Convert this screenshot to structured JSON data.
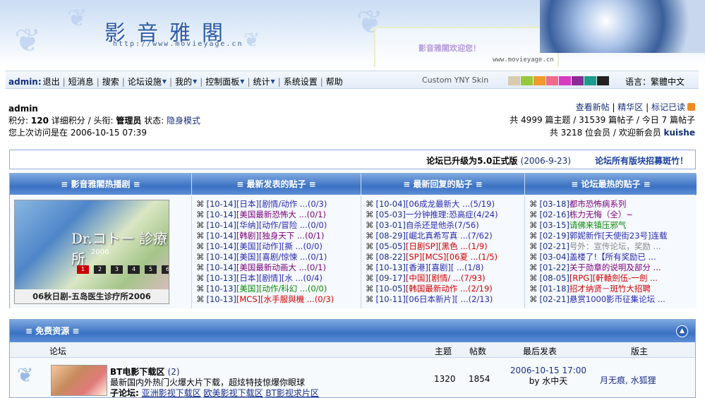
{
  "colors": {
    "accent": "#3b72c4",
    "link": "#14307a",
    "red": "#d40000",
    "green": "#0a8a0a"
  },
  "banner": {
    "logo": "影音雅閣",
    "logo_url": "http://www.movieyage.cn",
    "welcome": "影音雅閣欢迎您！",
    "site_url": "www.movieyage.cn"
  },
  "nav": {
    "user": "admin:",
    "items": [
      "退出",
      "短消息",
      "搜索",
      "论坛设施",
      "我的",
      "控制面板",
      "统计",
      "系统设置",
      "帮助"
    ],
    "skin": "Custom YNY Skin",
    "swatches": [
      "#d9cbb0",
      "#97c93b",
      "#f19a2e",
      "#f26a8a",
      "#d63bc2",
      "#8b2b94",
      "#1c9c8c",
      "#222222"
    ],
    "lang": "语言：繁體中文"
  },
  "user": {
    "name": "admin",
    "line2_pre": "积分:",
    "points": "120",
    "line2_mid": "详细积分 / 头衔:",
    "title": "管理员",
    "status_label": "状态:",
    "status": "隐身模式",
    "last_visit": "您上次访问是在 2006-10-15 07:39"
  },
  "stats": {
    "links": [
      "查看新帖",
      "精华区",
      "标记已读"
    ],
    "line2": "共 4999 篇主题 / 31539 篇帖子 / 今日 7 篇帖子",
    "line3_pre": "共 3218 位会员 / 欢迎新会员",
    "new_member": "kuishe"
  },
  "announce": {
    "msg": "论坛已升级为5.0正式版",
    "date": "(2006-9-23)",
    "recruit": "论坛所有版块招募斑竹！"
  },
  "hot": {
    "headers": [
      "≡ 影音雅閣热播剧 ≡",
      "≡ 最新发表的贴子 ≡",
      "≡ 最新回复的贴子 ≡",
      "≡ 论坛最热的贴子 ≡"
    ],
    "poster": {
      "title_art": "Dr.コトー 診療所",
      "year": "2006",
      "tiles": [
        "1",
        "2",
        "3",
        "4",
        "5",
        "6"
      ],
      "caption": "06秋日剧-五岛医生诊疗所2006"
    },
    "newest": [
      {
        "date": "[10-14]",
        "title": "[日本][剧情/动作 ...(0/3)",
        "color": "blue"
      },
      {
        "date": "[10-14]",
        "title": "[美国最新恐怖大 ...(0/1)",
        "color": "purple"
      },
      {
        "date": "[10-14]",
        "title": "[华纳][动作/冒险 ...(0/0)",
        "color": "blue"
      },
      {
        "date": "[10-14]",
        "title": "[韩剧][独身天下 ...(0/1)",
        "color": "purple"
      },
      {
        "date": "[10-14]",
        "title": "[美国][动作][撕 ...(0/0)",
        "color": "blue"
      },
      {
        "date": "[10-14]",
        "title": "[美国][喜剧/惊悚 ...(0/1)",
        "color": "blue"
      },
      {
        "date": "[10-14]",
        "title": "[美国最新动画大 ...(0/1)",
        "color": "purple"
      },
      {
        "date": "[10-13]",
        "title": "[日本][剧情][水 ...(0/4)",
        "color": "blue"
      },
      {
        "date": "[10-13]",
        "title": "[美国][动作/科幻 ...(0/0)",
        "color": "green"
      },
      {
        "date": "[10-13]",
        "title": "[MCS][水手服與機 ...(0/3)",
        "color": "red"
      }
    ],
    "replies": [
      {
        "date": "[10-04]",
        "title": "[06成龙最新大 ...(5/19)",
        "color": "blue"
      },
      {
        "date": "[05-03]",
        "title": "一分钟推理:恐高症(4/24)",
        "color": "blue"
      },
      {
        "date": "[03-01]",
        "title": "自杀还是他杀(7/56)",
        "color": "blue"
      },
      {
        "date": "[08-29]",
        "title": "[崛北真希写真 ...(7/62)",
        "color": "blue"
      },
      {
        "date": "[05-05]",
        "title": "[日剧SP][黑色 ...(1/9)",
        "color": "red"
      },
      {
        "date": "[08-22]",
        "title": "[SP][MCS][06夏 ...(1/5)",
        "color": "red"
      },
      {
        "date": "[10-13]",
        "title": "[香港][喜剧][ ...(1/8)",
        "color": "blue"
      },
      {
        "date": "[09-17]",
        "title": "[中国][剧情/ ...(7/93)",
        "color": "red"
      },
      {
        "date": "[10-05]",
        "title": "[韩国最新动作 ...(2/19)",
        "color": "red"
      },
      {
        "date": "[10-11]",
        "title": "[06日本新片][ ...(2/13)",
        "color": "blue"
      }
    ],
    "hottest": [
      {
        "date": "[03-18]",
        "title": "都市恐怖病系列",
        "color": "purple"
      },
      {
        "date": "[02-16]",
        "title": "栋力无悔（全）~",
        "color": "purple"
      },
      {
        "date": "[03-15]",
        "title": "请佛来镇压邪气",
        "color": "green"
      },
      {
        "date": "[02-19]",
        "title": "郭妮新作[天使街23号]连载",
        "color": "blue"
      },
      {
        "date": "[02-21]",
        "title": "号外：宣传论坛，奖励 ...",
        "color": "gray"
      },
      {
        "date": "[03-04]",
        "title": "盖楼了!【所有奖励已 ...",
        "color": "blue"
      },
      {
        "date": "[01-22]",
        "title": "关于勋章的说明及部分 ...",
        "color": "purple"
      },
      {
        "date": "[08-05]",
        "title": "[RPG][軒轅劍伍-一劍 ...",
        "color": "red"
      },
      {
        "date": "[01-18]",
        "title": "招才纳贤－斑竹大招聘",
        "color": "red"
      },
      {
        "date": "[02-21]",
        "title": "悬赏1000影币征集论坛 ...",
        "color": "blue"
      }
    ]
  },
  "free": {
    "header": "≡ 免费资源 ≡",
    "columns": {
      "forum": "论坛",
      "topics": "主题",
      "posts": "帖数",
      "last": "最后发表",
      "mods": "版主"
    },
    "row": {
      "name": "BT电影下载区",
      "count": "(2)",
      "desc": "最新国内外热门火爆大片下载，超炫特技惊爆你眼球",
      "sub_label": "子论坛:",
      "subs": [
        "亚洲影视下载区",
        "欧美影视下载区",
        "BT影视求片区"
      ],
      "topics": "1320",
      "posts": "1854",
      "last_time": "2006-10-15 17:00",
      "last_by": "by 水中天",
      "mods": "月无痕, 水狐狸"
    }
  }
}
